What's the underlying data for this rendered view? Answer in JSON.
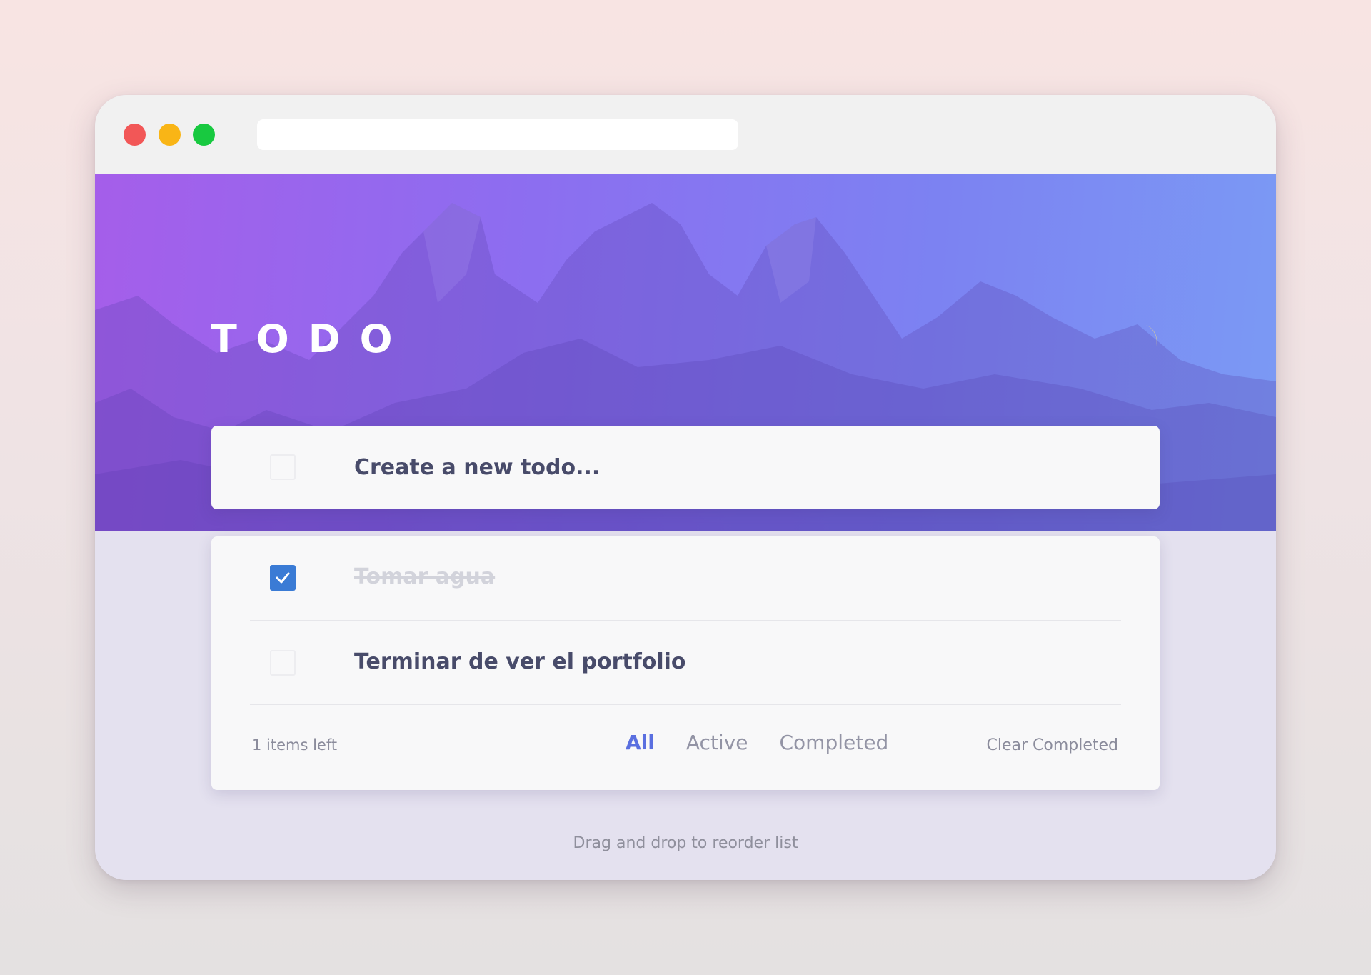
{
  "browser": {
    "window_buttons": [
      "close",
      "minimize",
      "maximize"
    ],
    "url": ""
  },
  "header": {
    "title": "TODO",
    "theme_toggle_icon": "moon-icon"
  },
  "new_todo": {
    "placeholder": "Create a new todo..."
  },
  "todos": [
    {
      "text": "Tomar agua",
      "completed": true
    },
    {
      "text": "Terminar de ver el portfolio",
      "completed": false
    }
  ],
  "footer": {
    "items_left": "1 items left",
    "filters": [
      {
        "label": "All",
        "active": true
      },
      {
        "label": "Active",
        "active": false
      },
      {
        "label": "Completed",
        "active": false
      }
    ],
    "clear_label": "Clear Completed"
  },
  "hint": "Drag and drop to reorder list",
  "colors": {
    "accent": "#5a6fe0",
    "checkbox_checked": "#3a7bd5",
    "text_primary": "#484b6a",
    "text_completed": "#d2d3db",
    "gradient_start": "#a55eea",
    "gradient_end": "#7b9af4",
    "close": "#f25757",
    "minimize": "#f9b516",
    "maximize": "#18c940"
  }
}
